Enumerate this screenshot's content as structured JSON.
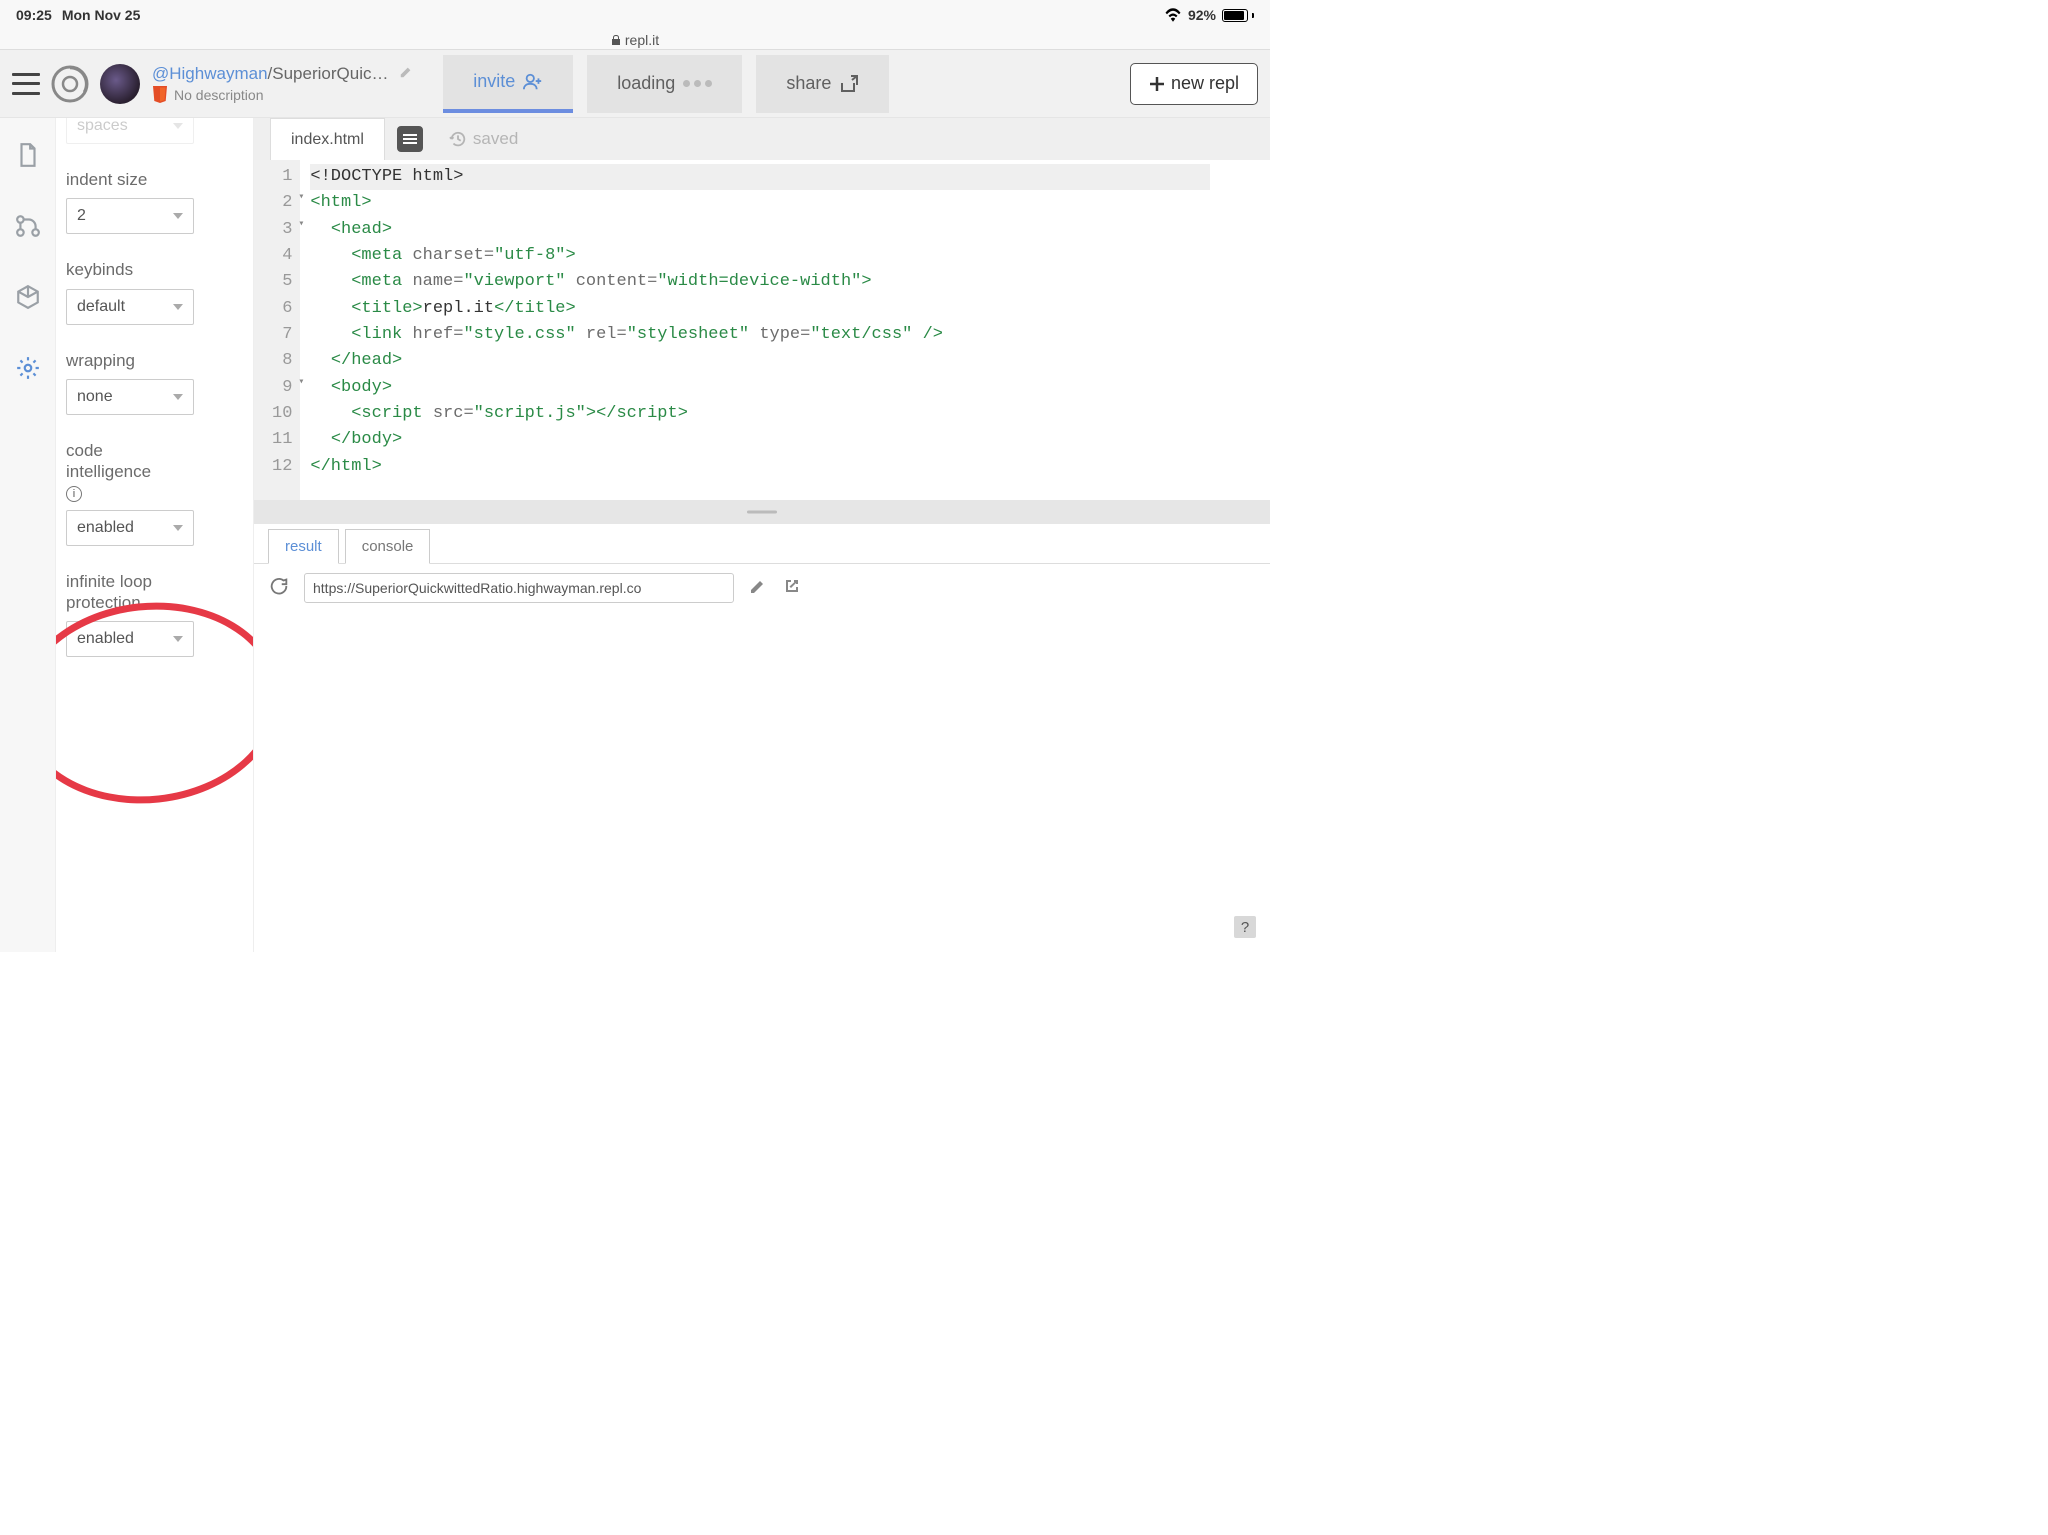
{
  "statusbar": {
    "time": "09:25",
    "date": "Mon Nov 25",
    "battery_pct": "92%"
  },
  "browser": {
    "domain": "repl.it"
  },
  "header": {
    "username": "@Highwayman",
    "slash": "/",
    "repl_name": "SuperiorQuic…",
    "no_description": "No description",
    "invite_label": "invite",
    "loading_label": "loading",
    "share_label": "share",
    "new_repl_label": "new repl"
  },
  "settings": {
    "spaces": {
      "label_cut": "spaces"
    },
    "indent_size": {
      "label": "indent size",
      "value": "2"
    },
    "keybinds": {
      "label": "keybinds",
      "value": "default"
    },
    "wrapping": {
      "label": "wrapping",
      "value": "none"
    },
    "code_intelligence": {
      "label_line1": "code",
      "label_line2": "intelligence",
      "value": "enabled"
    },
    "infinite_loop": {
      "label_line1": "infinite loop",
      "label_line2": "protection",
      "value": "enabled"
    }
  },
  "editor": {
    "filename": "index.html",
    "saved_label": "saved",
    "lines": {
      "count": 12
    }
  },
  "output": {
    "tab_result": "result",
    "tab_console": "console",
    "url": "https://SuperiorQuickwittedRatio.highwayman.repl.co"
  },
  "help": "?"
}
